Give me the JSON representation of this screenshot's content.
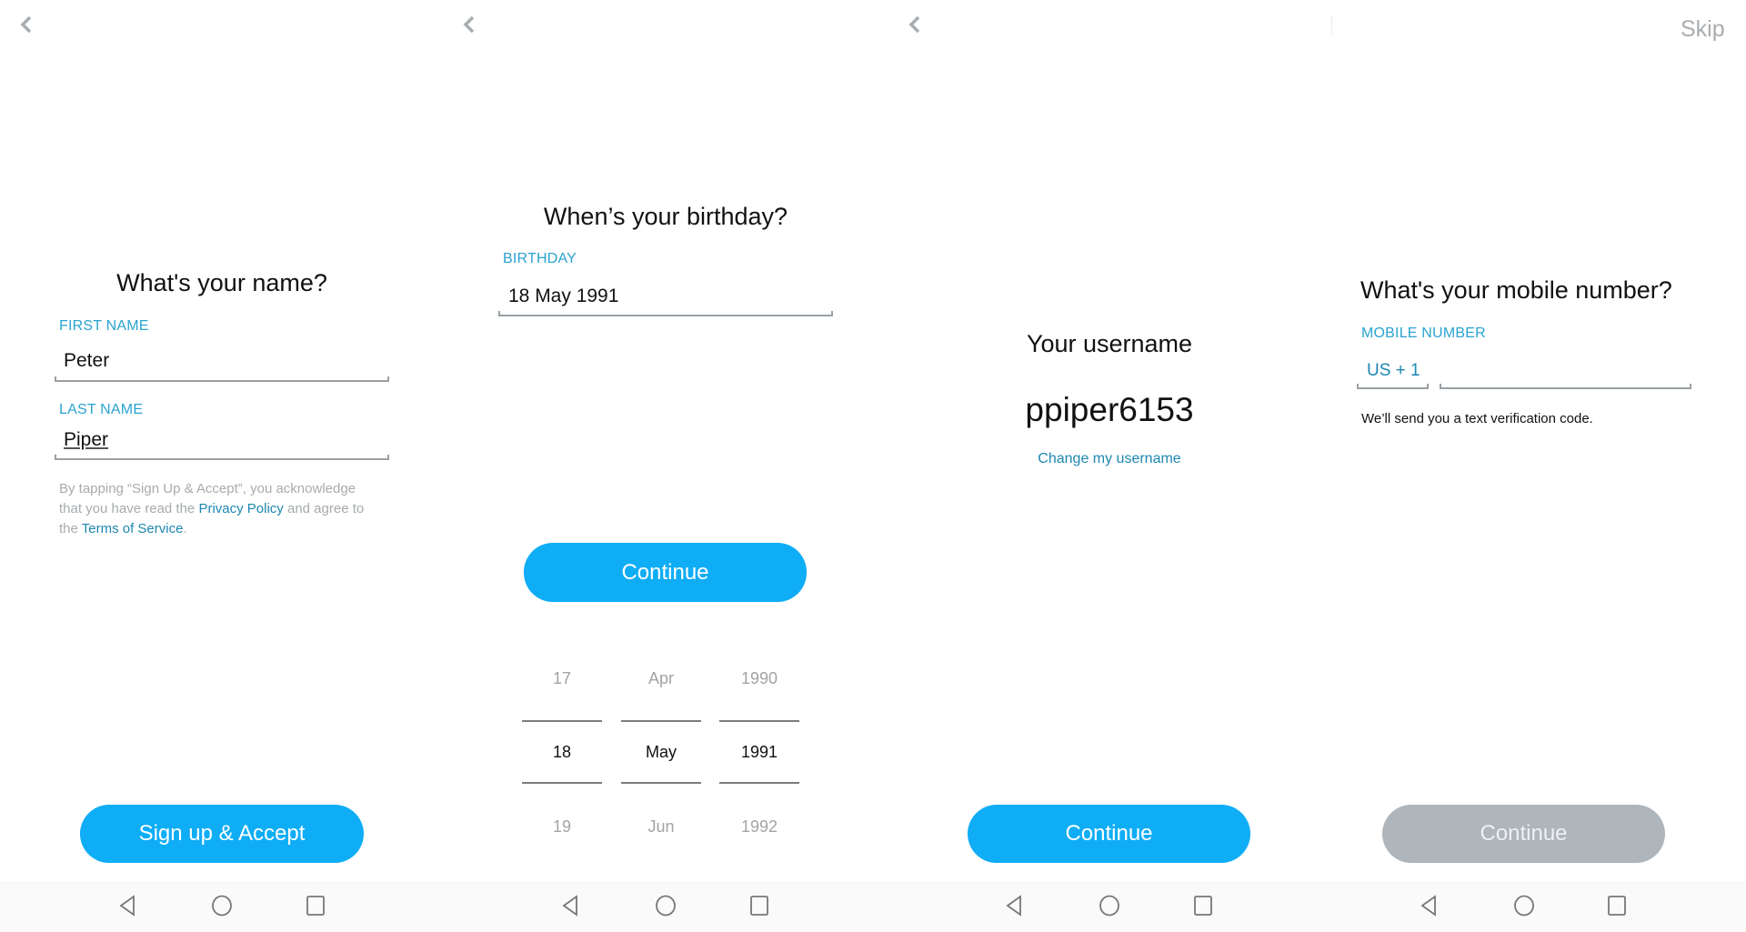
{
  "colors": {
    "accent": "#0fadf5",
    "label": "#2aa3cf",
    "link": "#1e87b0",
    "disabled": "#aeb5bb"
  },
  "screens": {
    "name": {
      "back_icon": "chevron-left",
      "title": "What's your name?",
      "first_name_label": "FIRST NAME",
      "first_name_value": "Peter",
      "last_name_label": "LAST NAME",
      "last_name_value": "Piper",
      "legal_prefix": "By tapping “Sign Up & Accept”, you acknowledge that you have read the ",
      "privacy_link": "Privacy Policy",
      "legal_middle": " and agree to the ",
      "terms_link": "Terms of Service",
      "legal_suffix": ".",
      "button_label": "Sign up & Accept"
    },
    "birthday": {
      "back_icon": "chevron-left",
      "title": "When’s your birthday?",
      "label": "BIRTHDAY",
      "value": "18 May 1991",
      "button_label": "Continue",
      "picker": {
        "day": {
          "prev": "17",
          "selected": "18",
          "next": "19"
        },
        "month": {
          "prev": "Apr",
          "selected": "May",
          "next": "Jun"
        },
        "year": {
          "prev": "1990",
          "selected": "1991",
          "next": "1992"
        }
      }
    },
    "username": {
      "back_icon": "chevron-left",
      "title": "Your username",
      "username": "ppiper6153",
      "change_link": "Change my username",
      "button_label": "Continue"
    },
    "mobile": {
      "skip_label": "Skip",
      "title": "What's your mobile number?",
      "label": "MOBILE NUMBER",
      "country_code": "US + 1",
      "number_value": "",
      "helper": "We’ll send you a text verification code.",
      "button_label": "Continue",
      "button_enabled": false
    }
  },
  "navbar": {
    "icons": [
      "back-triangle",
      "home-circle",
      "recents-square"
    ]
  }
}
